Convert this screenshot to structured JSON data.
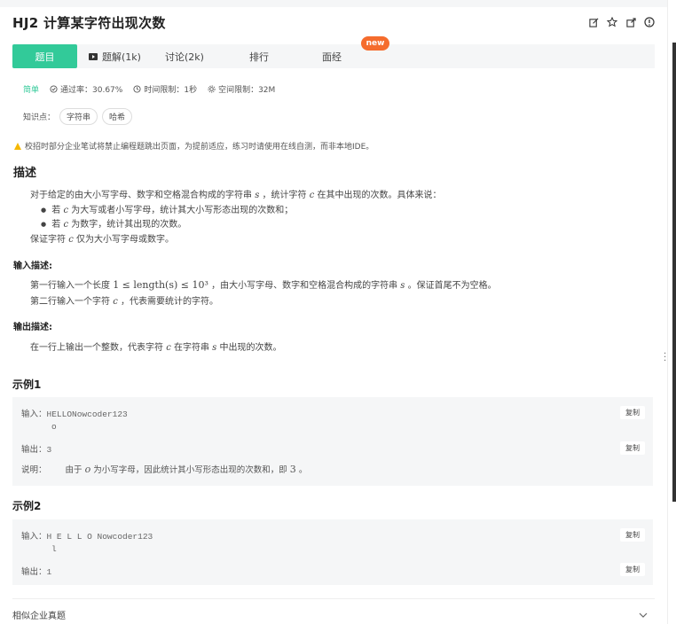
{
  "header": {
    "title": "HJ2  计算某字符出现次数",
    "icons": [
      "edit-icon",
      "star-icon",
      "share-icon",
      "info-icon"
    ]
  },
  "tabs": [
    {
      "label": "题目",
      "active": true
    },
    {
      "label": "题解(1k)",
      "icon": "video-icon"
    },
    {
      "label": "讨论(2k)"
    },
    {
      "label": "排行"
    },
    {
      "label": "面经",
      "badge": "new"
    }
  ],
  "meta": {
    "difficulty": "简单",
    "pass_rate": "通过率：30.67%",
    "time_limit": "时间限制：1秒",
    "space_limit": "空间限制：32M"
  },
  "knowledge": {
    "label": "知识点：",
    "tags": [
      "字符串",
      "哈希"
    ]
  },
  "warning": "校招时部分企业笔试将禁止编程题跳出页面，为提前适应，练习时请使用在线自测，而非本地IDE。",
  "description": {
    "heading": "描述",
    "p1_a": "对于给定的由大小写字母、数字和空格混合构成的字符串",
    "p1_s": "s",
    "p1_b": "，统计字符",
    "p1_c": "c",
    "p1_d": "在其中出现的次数。具体来说：",
    "b1_a": "若",
    "b1_c": "c",
    "b1_b": "为大写或者小写字母，统计其大小写形态出现的次数和；",
    "b2_a": "若",
    "b2_c": "c",
    "b2_b": "为数字，统计其出现的次数。",
    "p2_a": "保证字符",
    "p2_c": "c",
    "p2_b": "仅为大小写字母或数字。"
  },
  "input_desc": {
    "heading": "输入描述:",
    "l1_a": "第一行输入一个长度",
    "l1_m": "1 ≤ length(s) ≤ 10³",
    "l1_b": "，由大小写字母、数字和空格混合构成的字符串",
    "l1_s": "s",
    "l1_c": "。保证首尾不为空格。",
    "l2_a": "第二行输入一个字符",
    "l2_c": "c",
    "l2_b": "，代表需要统计的字符。"
  },
  "output_desc": {
    "heading": "输出描述:",
    "l1_a": "在一行上输出一个整数，代表字符",
    "l1_c": "c",
    "l1_b": "在字符串",
    "l1_s": "s",
    "l1_d": "中出现的次数。"
  },
  "example1": {
    "heading": "示例1",
    "input_label": "输入：",
    "input_line1": "HELLONowcoder123",
    "input_line2": "o",
    "output_label": "输出：",
    "output": "3",
    "note_label": "说明：",
    "note_a": "由于",
    "note_o": "o",
    "note_b": "为小写字母，因此统计其小写形态出现的次数和，即",
    "note_n": "3",
    "note_c": "。",
    "copy": "复制"
  },
  "example2": {
    "heading": "示例2",
    "input_label": "输入：",
    "input_line1": "H E L L O Nowcoder123",
    "input_line2": "l",
    "output_label": "输出：",
    "output": "1",
    "copy": "复制"
  },
  "similar": {
    "label": "相似企业真题"
  }
}
